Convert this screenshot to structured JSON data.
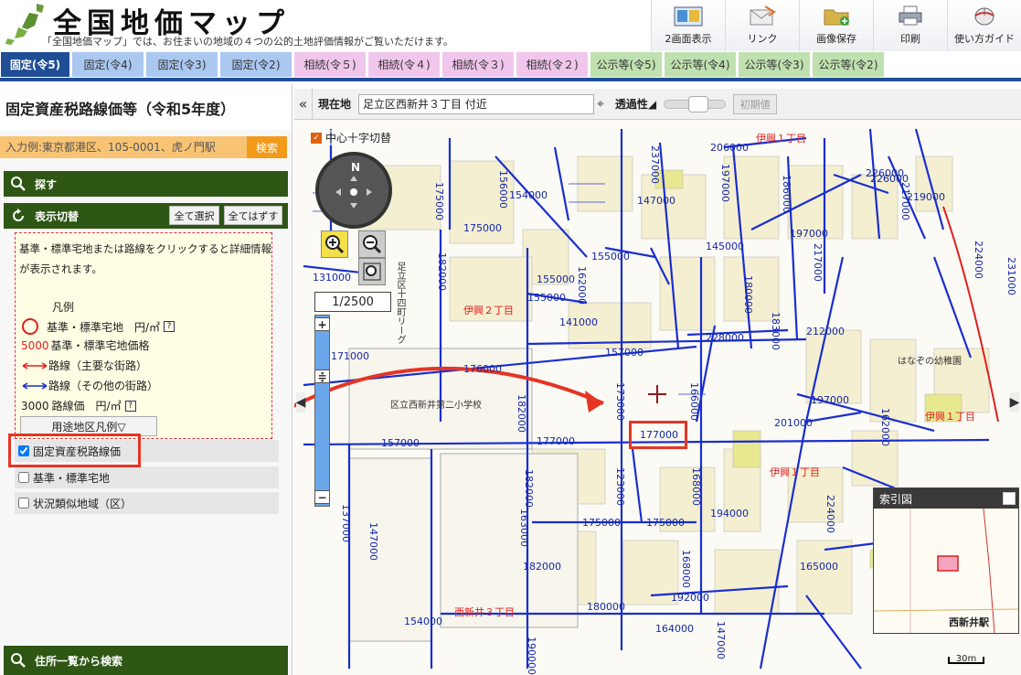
{
  "header": {
    "title": "全国地価マップ",
    "subtitle": "「全国地価マップ」では、お住まいの地域の４つの公的土地評価情報がご覧いただけます。",
    "tools": [
      {
        "label": "2画面表示",
        "icon": "dual-screen-icon"
      },
      {
        "label": "リンク",
        "icon": "link-mail-icon"
      },
      {
        "label": "画像保存",
        "icon": "folder-save-icon"
      },
      {
        "label": "印刷",
        "icon": "printer-icon"
      },
      {
        "label": "使い方ガイド",
        "icon": "mouse-icon"
      }
    ]
  },
  "tabs": [
    {
      "label": "固定(令5)",
      "style": "blue",
      "active": true
    },
    {
      "label": "固定(令4)",
      "style": "blue"
    },
    {
      "label": "固定(令3)",
      "style": "blue"
    },
    {
      "label": "固定(令2)",
      "style": "blue"
    },
    {
      "label": "相続(令５)",
      "style": "pink"
    },
    {
      "label": "相続(令４)",
      "style": "pink"
    },
    {
      "label": "相続(令３)",
      "style": "pink"
    },
    {
      "label": "相続(令２)",
      "style": "pink"
    },
    {
      "label": "公示等(令5)",
      "style": "green"
    },
    {
      "label": "公示等(令4)",
      "style": "green"
    },
    {
      "label": "公示等(令3)",
      "style": "green"
    },
    {
      "label": "公示等(令2)",
      "style": "green"
    }
  ],
  "panel": {
    "title": "固定資産税路線価等（令和5年度）",
    "search_placeholder": "入力例:東京都港区、105-0001、虎ノ門駅",
    "search_button": "検索",
    "section_find": "探す",
    "section_display": "表示切替",
    "select_all": "全て選択",
    "deselect_all": "全てはずす",
    "hint": "基準・標準宅地または路線をクリックすると詳細情報が表示されます。",
    "legend_title": "凡例",
    "legend": {
      "standard_land": "基準・標準宅地　円/㎡",
      "price_sample": "5000",
      "price_label": "基準・標準宅地価格",
      "main_street": "路線（主要な街路）",
      "other_street": "路線（その他の街路）",
      "route_price_sample": "3000",
      "route_price_label": "路線価　円/㎡"
    },
    "zoning_legend_button": "用途地区凡例▽",
    "checks": [
      {
        "label": "固定資産税路線価",
        "checked": true
      },
      {
        "label": "基準・標準宅地",
        "checked": false
      },
      {
        "label": "状況類似地域（区）",
        "checked": false
      }
    ],
    "section_address": "住所一覧から検索"
  },
  "maptop": {
    "location_label": "現在地",
    "location_value": "足立区西新井３丁目 付近",
    "opacity_label": "透過性◢",
    "reset_button": "初期値"
  },
  "map": {
    "center_toggle": "中心十字切替",
    "compass_n": "N",
    "scale": "1/2500",
    "index_title": "索引図",
    "index_station": "西新井駅",
    "scalebar": "30m",
    "areas": [
      "伊興１丁目",
      "伊興２丁目",
      "伊興１丁目",
      "伊興１丁目",
      "西新井３丁目"
    ],
    "places": [
      "区立西新井第二小学校",
      "はなぞの幼稚園",
      "足立区十四町リーグ"
    ],
    "prices_h": [
      "206000",
      "154000",
      "175000",
      "147000",
      "145000",
      "131000",
      "155000",
      "155000",
      "155000",
      "141000",
      "197000",
      "226000",
      "219000",
      "212000",
      "228000",
      "157000",
      "171000",
      "176000",
      "197000",
      "201000",
      "177000",
      "157000",
      "177000",
      "175000",
      "175000",
      "194000",
      "165000",
      "182000",
      "180000",
      "192000",
      "154000",
      "164000",
      "226000"
    ],
    "prices_v": [
      "175000",
      "182000",
      "156000",
      "237000",
      "197000",
      "186000",
      "217000",
      "224000",
      "231000",
      "217000",
      "162000",
      "166000",
      "173000",
      "182000",
      "183000",
      "180000",
      "162000",
      "224000",
      "168000",
      "182000",
      "137000",
      "147000",
      "123000",
      "168000",
      "163000",
      "147000",
      "190000"
    ]
  }
}
